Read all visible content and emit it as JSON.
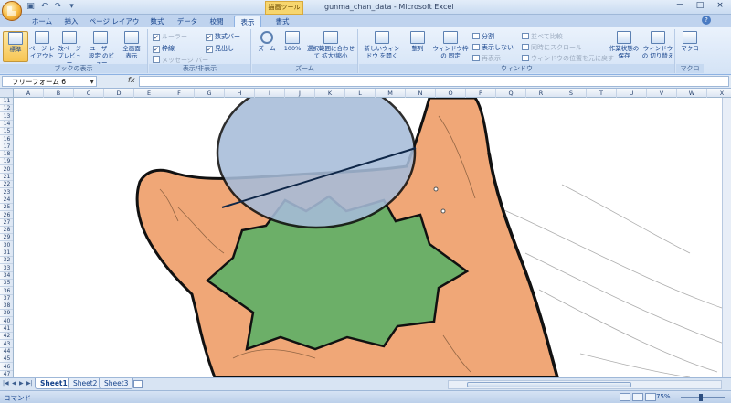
{
  "title_bar": {
    "context_tab": "描画ツール",
    "window_title": "gunma_chan_data - Microsoft Excel",
    "controls": [
      "－",
      "□",
      "×"
    ]
  },
  "ribbon_tabs": [
    "ホーム",
    "挿入",
    "ページ レイアウト",
    "数式",
    "データ",
    "校閲",
    "表示",
    "書式"
  ],
  "active_tab": "表示",
  "ribbon": {
    "book_views": {
      "label": "ブックの表示",
      "buttons": [
        "標準",
        "ページ レイアウト",
        "改ページ プレビュー",
        "ユーザー設定 のビュー",
        "全画面 表示"
      ]
    },
    "show_hide": {
      "label": "表示/非表示",
      "checks": [
        {
          "label": "ルーラー",
          "checked": true,
          "disabled": true
        },
        {
          "label": "枠線",
          "checked": true,
          "disabled": false
        },
        {
          "label": "メッセージ バー",
          "checked": false,
          "disabled": true
        },
        {
          "label": "数式バー",
          "checked": true,
          "disabled": false
        },
        {
          "label": "見出し",
          "checked": true,
          "disabled": false
        }
      ]
    },
    "zoom": {
      "label": "ズーム",
      "buttons": [
        "ズーム",
        "100%",
        "選択範囲に合わせて 拡大/縮小"
      ]
    },
    "window": {
      "label": "ウィンドウ",
      "big": [
        "新しいウィンドウ を開く",
        "整列",
        "ウィンドウ枠の 固定"
      ],
      "small": [
        {
          "label": "分割",
          "disabled": false
        },
        {
          "label": "表示しない",
          "disabled": false
        },
        {
          "label": "再表示",
          "disabled": true
        },
        {
          "label": "並べて比較",
          "disabled": true
        },
        {
          "label": "同時にスクロール",
          "disabled": true
        },
        {
          "label": "ウィンドウの位置を元に戻す",
          "disabled": true
        }
      ],
      "big2": [
        "作業状態の 保存",
        "ウィンドウの 切り替え"
      ]
    },
    "macro": {
      "label": "マクロ",
      "buttons": [
        "マクロ"
      ]
    }
  },
  "formula_bar": {
    "name_box": "フリーフォーム 6",
    "fx": "fx",
    "value": ""
  },
  "columns": [
    "A",
    "B",
    "C",
    "D",
    "E",
    "F",
    "G",
    "H",
    "I",
    "J",
    "K",
    "L",
    "M",
    "N",
    "O",
    "P",
    "Q",
    "R",
    "S",
    "T",
    "U",
    "V",
    "W",
    "X"
  ],
  "rows": [
    "11",
    "12",
    "13",
    "14",
    "15",
    "16",
    "17",
    "18",
    "19",
    "20",
    "21",
    "22",
    "23",
    "24",
    "25",
    "26",
    "27",
    "28",
    "29",
    "30",
    "31",
    "32",
    "33",
    "34",
    "35",
    "36",
    "37",
    "38",
    "39",
    "40",
    "41",
    "42",
    "43",
    "44",
    "45",
    "46",
    "47"
  ],
  "sheet_tabs": [
    "Sheet1",
    "Sheet2",
    "Sheet3"
  ],
  "active_sheet": "Sheet1",
  "status": {
    "mode": "コマンド",
    "zoom": "75%",
    "zoom_fraction": 0.45
  },
  "colors": {
    "skin": "#F0A777",
    "ellipse": "#A7BCD9",
    "star": "#6CAF68",
    "outline": "#111111"
  }
}
